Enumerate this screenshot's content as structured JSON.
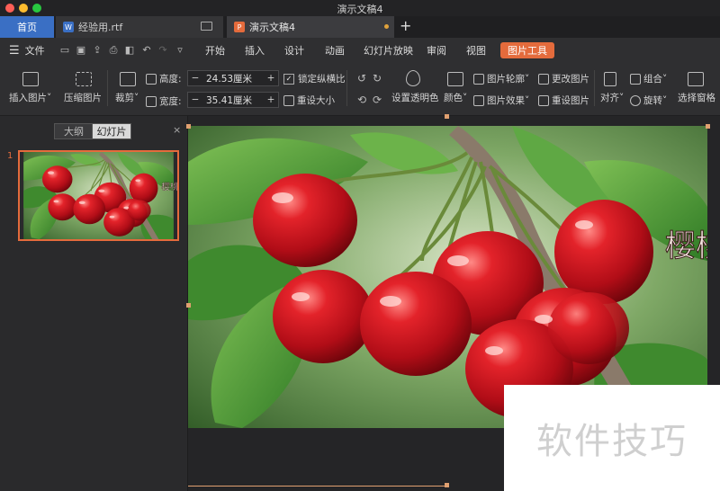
{
  "window": {
    "title": "演示文稿4"
  },
  "tabs": {
    "home": "首页",
    "doc1": {
      "label": "经验用.rtf",
      "icon": "W"
    },
    "doc2": {
      "label": "演示文稿4",
      "icon": "P"
    },
    "new_tab": "+"
  },
  "menu": {
    "file": "文件",
    "items": [
      "开始",
      "插入",
      "设计",
      "动画",
      "幻灯片放映",
      "审阅",
      "视图"
    ],
    "active": "图片工具"
  },
  "ribbon": {
    "insert_picture": "插入图片",
    "compress_picture": "压缩图片",
    "crop": "裁剪",
    "height_label": "高度:",
    "height_value": "24.53厘米",
    "width_label": "宽度:",
    "width_value": "35.41厘米",
    "lock_ratio": "锁定纵横比",
    "reset_size": "重设大小",
    "set_transparent": "设置透明色",
    "color": "颜色",
    "picture_outline": "图片轮廓",
    "picture_effect": "图片效果",
    "change_picture": "更改图片",
    "reset_picture": "重设图片",
    "align": "对齐",
    "group": "组合",
    "rotate": "旋转",
    "selection_pane": "选择窗格"
  },
  "left_panel": {
    "tab_outline": "大纲",
    "tab_slides": "幻灯片",
    "slide_number": "1"
  },
  "slide": {
    "image_text": "樱桃"
  },
  "watermark": "软件技巧",
  "colors": {
    "accent": "#e46b3c",
    "home_tab": "#3a6fc4",
    "doc1_icon": "#3a6fc4",
    "doc2_icon": "#e46b3c"
  }
}
